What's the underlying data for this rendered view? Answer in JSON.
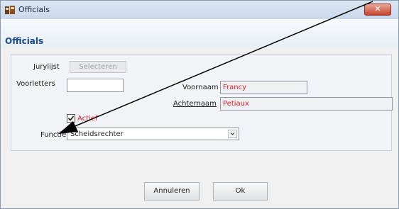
{
  "window": {
    "title": "Officials",
    "close_icon": "✕"
  },
  "header": {
    "title": "Officials"
  },
  "form": {
    "jurylijst_label": "Jurylijst",
    "selecteren_label": "Selecteren",
    "voorletters_label": "Voorletters",
    "voorletters_value": "",
    "voornaam_label": "Voornaam",
    "voornaam_value": "Francy",
    "achternaam_label": "Achternaam",
    "achternaam_value": "Petiaux",
    "actief_label": "Actief",
    "actief_checked": true,
    "functie_label": "Functie",
    "functie_value": "Scheidsrechter"
  },
  "buttons": {
    "cancel": "Annuleren",
    "ok": "Ok"
  },
  "colors": {
    "value_red": "#e0202a",
    "header_blue": "#1a4a8a",
    "close_red": "#c7432b"
  },
  "icons": {
    "app": "officials-app-icon",
    "dropdown": "chevron-down-icon",
    "check": "check-icon"
  }
}
